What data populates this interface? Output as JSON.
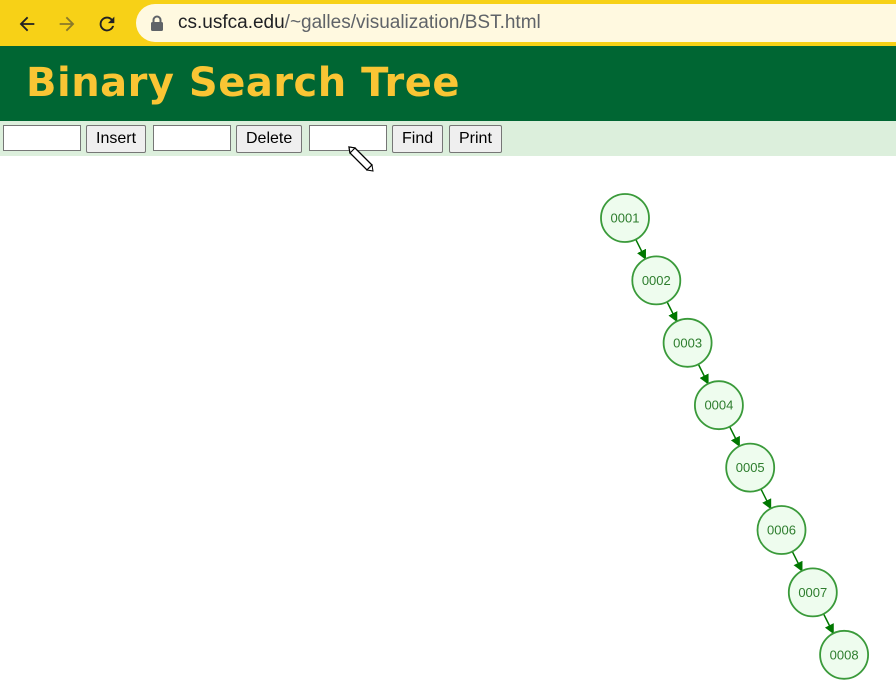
{
  "browser": {
    "url_host": "cs.usfca.edu",
    "url_path": "/~galles/visualization/BST.html",
    "back_icon": "arrow-left-icon",
    "forward_icon": "arrow-right-icon",
    "reload_icon": "reload-icon",
    "lock_icon": "lock-icon"
  },
  "header": {
    "title": "Binary Search Tree"
  },
  "controls": {
    "insert_value": "",
    "insert_label": "Insert",
    "delete_value": "",
    "delete_label": "Delete",
    "find_value": "",
    "find_label": "Find",
    "print_label": "Print"
  },
  "tree": {
    "nodes": [
      "0001",
      "0002",
      "0003",
      "0004",
      "0005",
      "0006",
      "0007",
      "0008"
    ],
    "edges": [
      [
        "0001",
        "0002"
      ],
      [
        "0002",
        "0003"
      ],
      [
        "0003",
        "0004"
      ],
      [
        "0004",
        "0005"
      ],
      [
        "0005",
        "0006"
      ],
      [
        "0006",
        "0007"
      ],
      [
        "0007",
        "0008"
      ]
    ],
    "edge_color": "#007700",
    "node_stroke": "#3a9a3a",
    "node_fill": "#eefcee",
    "node_text": "#2d7d2d"
  },
  "colors": {
    "chrome": "#f7d117",
    "banner": "#006633",
    "title": "#f9c534",
    "control_bar": "#dcefdc"
  }
}
